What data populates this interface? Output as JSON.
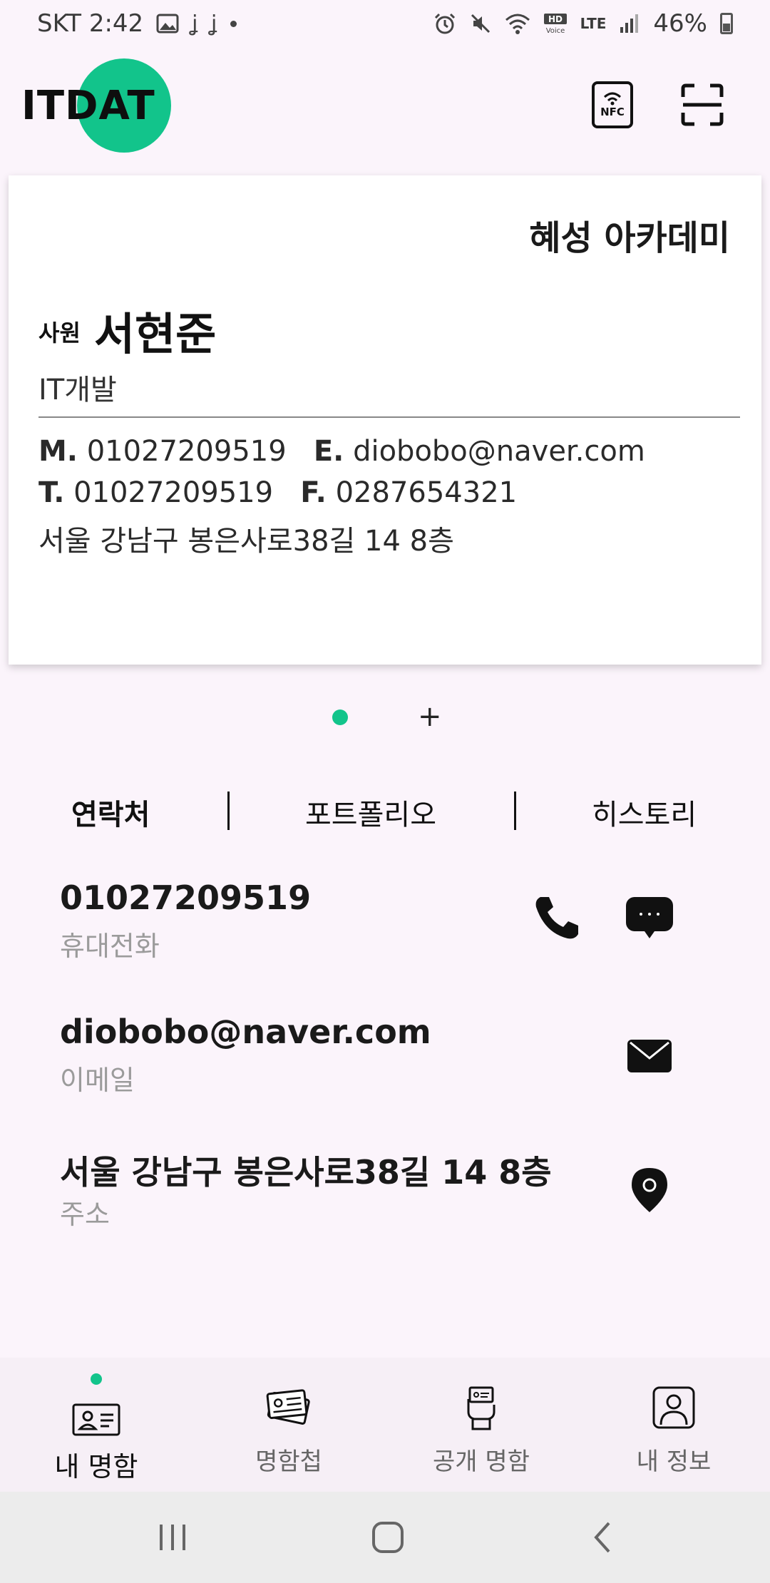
{
  "status_bar": {
    "carrier_time": "SKT 2:42",
    "glyphs": [
      "ʝ",
      "ʝ"
    ],
    "network": "LTE",
    "battery": "46%"
  },
  "app": {
    "logo_text": "ITDAT",
    "brand_color": "#12c48b",
    "nfc_label": "NFC"
  },
  "card": {
    "company": "혜성 아카데미",
    "position": "사원",
    "name": "서현준",
    "department": "IT개발",
    "mobile_prefix": "M.",
    "mobile": "01027209519",
    "email_prefix": "E.",
    "email": "diobobo@naver.com",
    "tel_prefix": "T.",
    "tel": "01027209519",
    "fax_prefix": "F.",
    "fax": "0287654321",
    "address": "서울 강남구 봉은사로38길 14 8층"
  },
  "pager": {
    "add": "+"
  },
  "tabs": {
    "contact": "연락처",
    "portfolio": "포트폴리오",
    "history": "히스토리"
  },
  "contacts": [
    {
      "value": "01027209519",
      "label": "휴대전화"
    },
    {
      "value": "diobobo@naver.com",
      "label": "이메일"
    },
    {
      "value": "서울 강남구 봉은사로38길 14 8층",
      "label": "주소"
    }
  ],
  "bottom_nav": {
    "my_card": "내 명함",
    "card_holder": "명함첩",
    "public_card": "공개 명함",
    "my_info": "내 정보"
  }
}
